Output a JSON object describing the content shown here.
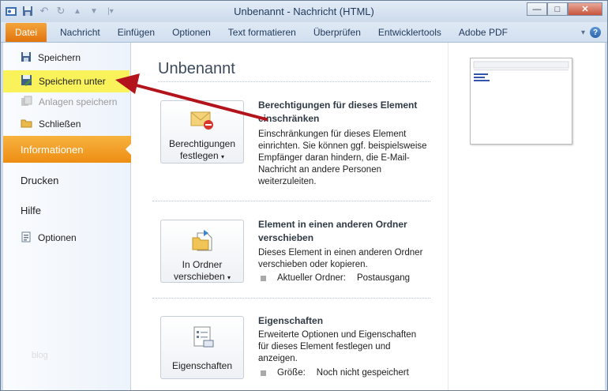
{
  "window": {
    "title": "Unbenannt  -  Nachricht (HTML)",
    "controls": {
      "minimize": "—",
      "maximize": "□",
      "close": "✕"
    }
  },
  "ribbon": {
    "tabs": [
      "Datei",
      "Nachricht",
      "Einfügen",
      "Optionen",
      "Text formatieren",
      "Überprüfen",
      "Entwicklertools",
      "Adobe PDF"
    ],
    "help_icon": "question-icon"
  },
  "nav": {
    "commands": [
      {
        "label": "Speichern",
        "icon": "save-icon"
      },
      {
        "label": "Speichern unter",
        "icon": "save-as-icon"
      },
      {
        "label": "Anlagen speichern",
        "icon": "attachments-icon"
      },
      {
        "label": "Schließen",
        "icon": "folder-icon"
      }
    ],
    "tabs": [
      "Informationen",
      "Drucken",
      "Hilfe"
    ],
    "options_label": "Optionen",
    "faded_text": "blog"
  },
  "main": {
    "title": "Unbenannt",
    "permissions": {
      "button_label_1": "Berechtigungen",
      "button_label_2": "festlegen",
      "title": "Berechtigungen für dieses Element einschränken",
      "description": "Einschränkungen für dieses Element einrichten. Sie können ggf. beispielsweise Empfänger daran hindern, die E-Mail-Nachricht an andere Personen weiterzuleiten."
    },
    "move": {
      "button_label_1": "In Ordner",
      "button_label_2": "verschieben",
      "title": "Element in einen anderen Ordner verschieben",
      "description": "Dieses Element in einen anderen Ordner verschieben oder kopieren.",
      "prop_label": "Aktueller Ordner:",
      "prop_value": "Postausgang"
    },
    "properties": {
      "button_label": "Eigenschaften",
      "title": "Eigenschaften",
      "description": "Erweiterte Optionen und Eigenschaften für dieses Element festlegen und anzeigen.",
      "prop_label": "Größe:",
      "prop_value": "Noch nicht gespeichert"
    }
  },
  "colors": {
    "file_tab": "#e2740d",
    "active_nav": "#ee8d14",
    "highlight": "#faf25a",
    "arrow": "#b3141c"
  }
}
